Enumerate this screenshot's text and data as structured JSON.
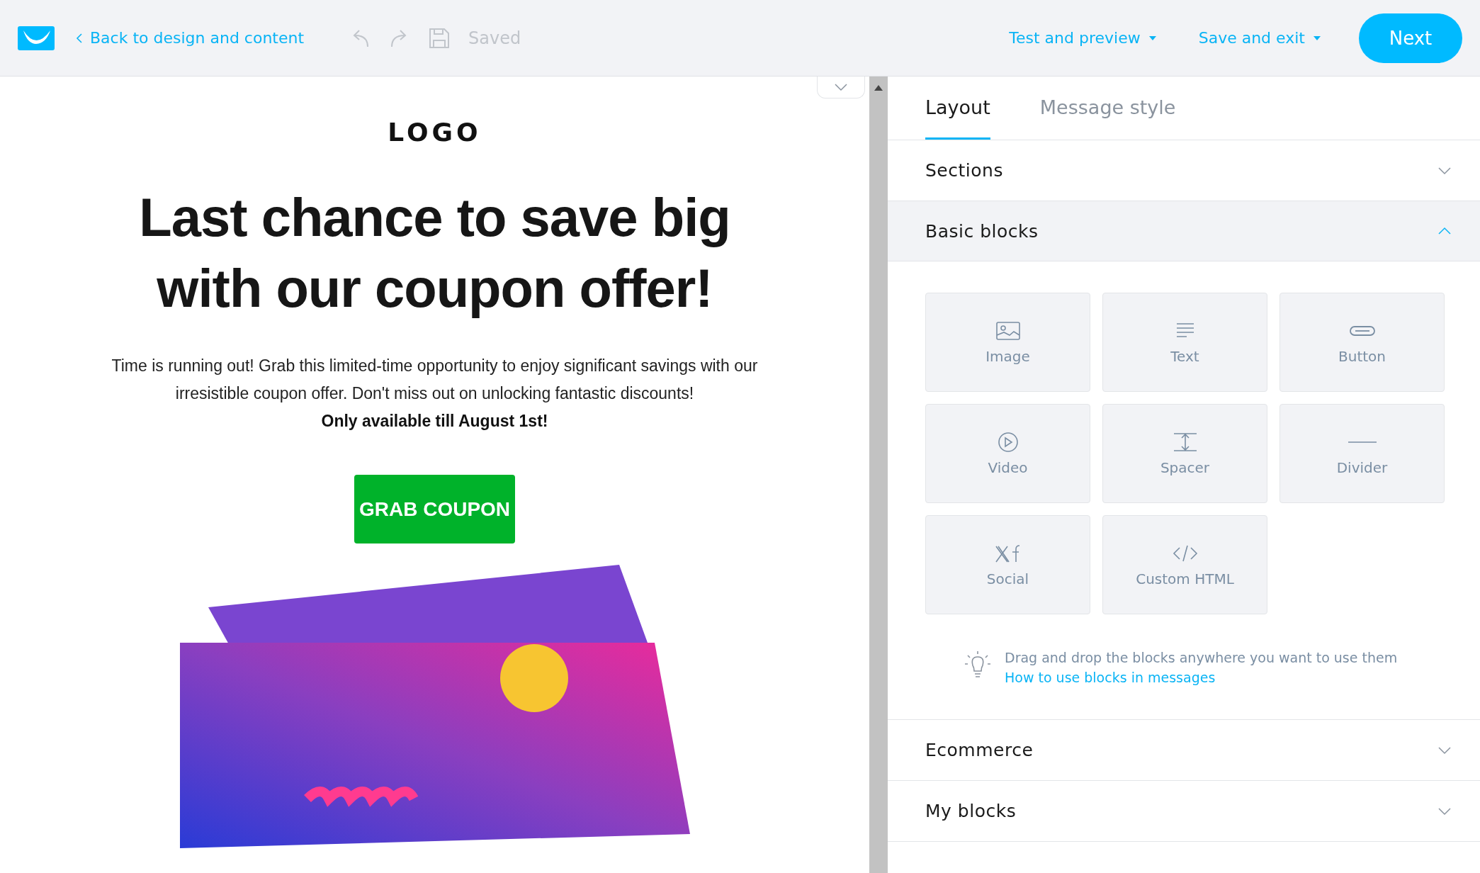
{
  "topbar": {
    "back_link": "Back to design and content",
    "save_status": "Saved",
    "menus": [
      {
        "label": "Test and preview"
      },
      {
        "label": "Save and exit"
      }
    ],
    "next_button": "Next"
  },
  "email": {
    "logo": "LOGO",
    "headline": "Last chance to save big with our coupon offer!",
    "body": "Time is running out! Grab this limited-time opportunity to enjoy significant savings with our irresistible coupon offer. Don't miss out on unlocking fantastic discounts!",
    "note": "Only available till August 1st!",
    "cta": "GRAB COUPON"
  },
  "panel": {
    "tabs": [
      {
        "label": "Layout",
        "selected": true
      },
      {
        "label": "Message style",
        "selected": false
      }
    ],
    "sections": [
      {
        "title": "Sections",
        "expanded": false
      },
      {
        "title": "Basic blocks",
        "expanded": true,
        "blocks": [
          {
            "label": "Image",
            "kind": "image"
          },
          {
            "label": "Text",
            "kind": "text"
          },
          {
            "label": "Button",
            "kind": "button"
          },
          {
            "label": "Video",
            "kind": "video"
          },
          {
            "label": "Spacer",
            "kind": "spacer"
          },
          {
            "label": "Divider",
            "kind": "divider"
          },
          {
            "label": "Social",
            "kind": "social"
          },
          {
            "label": "Custom HTML",
            "kind": "html"
          }
        ],
        "hint": "Drag and drop the blocks anywhere you want to use them",
        "hint_link": "How to use blocks in messages"
      },
      {
        "title": "Ecommerce",
        "expanded": false
      },
      {
        "title": "My blocks",
        "expanded": false
      }
    ]
  }
}
